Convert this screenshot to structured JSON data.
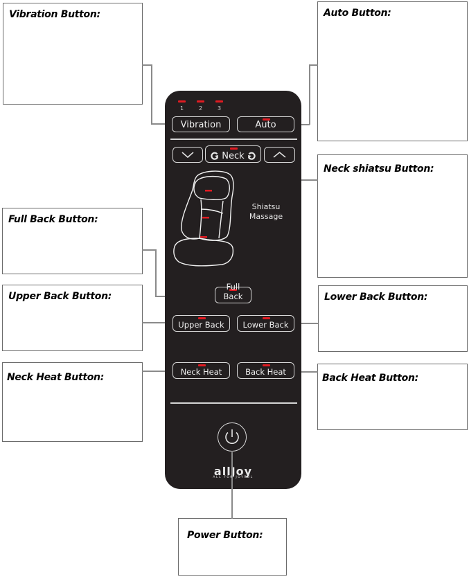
{
  "labels": {
    "vibration": "Vibration Button:",
    "auto": "Auto Button:",
    "neck_shiatsu": "Neck shiatsu Button:",
    "full_back": "Full Back Button:",
    "upper_back": "Upper Back Button:",
    "lower_back": "Lower Back Button:",
    "neck_heat": "Neck Heat Button:",
    "back_heat": "Back Heat Button:",
    "power": "Power Button:"
  },
  "remote": {
    "vibration_levels": [
      "1",
      "2",
      "3"
    ],
    "buttons": {
      "vibration": "Vibration",
      "auto": "Auto",
      "neck": "Neck",
      "full_back": "Full Back",
      "upper_back": "Upper Back",
      "lower_back": "Lower Back",
      "neck_heat": "Neck Heat",
      "back_heat": "Back Heat"
    },
    "shiatsu_label_line1": "Shiatsu",
    "shiatsu_label_line2": "Massage",
    "logo_name": "allJoy",
    "logo_tagline": "ALL FOR JOYFUL",
    "icons": {
      "down": "chevron-down-icon",
      "up": "chevron-up-icon",
      "rotate_left": "rotate-ccw-icon",
      "rotate_right": "rotate-cw-icon",
      "power": "power-icon"
    }
  },
  "colors": {
    "remote_body": "#231f20",
    "led": "#e11b22",
    "button_outline": "#d8d8d8",
    "connector": "#8a8a8a"
  }
}
